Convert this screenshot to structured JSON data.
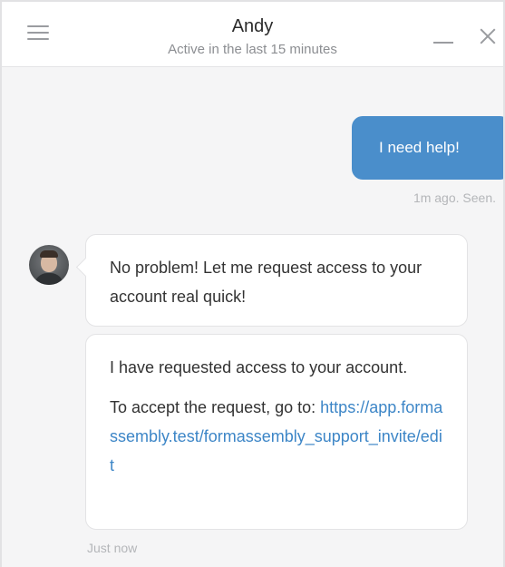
{
  "header": {
    "agent_name": "Andy",
    "agent_status": "Active in the last 15 minutes",
    "menu_icon": "hamburger-menu-icon",
    "minimize_icon": "minimize-icon",
    "close_icon": "close-icon"
  },
  "messages": {
    "outgoing": {
      "text": "I need help!",
      "meta": "1m ago. Seen."
    },
    "incoming": [
      {
        "paragraphs": [
          "No problem! Let me request access to your account real quick!"
        ]
      },
      {
        "paragraphs": [
          "I have requested access to your account."
        ],
        "link_intro": "To accept the request, go to:",
        "link_text": "https://app.formassembly.test/formassembly_support_invite/edit"
      }
    ],
    "incoming_meta": "Just now"
  },
  "colors": {
    "outgoing_bubble": "#4a8ecb",
    "link": "#3d86c7",
    "background": "#f5f5f6"
  }
}
